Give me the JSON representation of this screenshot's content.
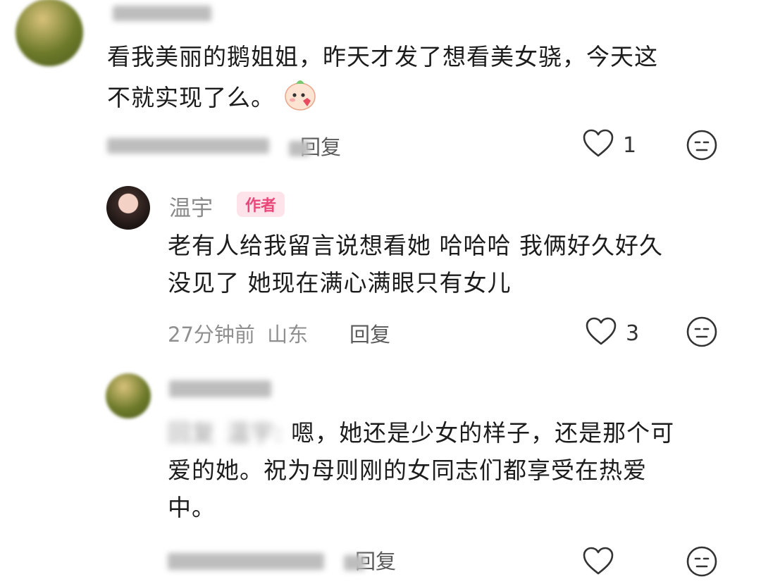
{
  "comments": [
    {
      "author_name": "",
      "text_line1": "看我美丽的鹅姐姐，昨天才发了想看美女骁，今天这",
      "text_line2": "不就实现了么。",
      "reply_label": "回复",
      "like_count": "1"
    },
    {
      "author_name": "温宇",
      "author_tag": "作者",
      "text_line1": "老有人给我留言说想看她 哈哈哈 我俩好久好久",
      "text_line2": "没见了 她现在满心满眼只有女儿",
      "time": "27分钟前",
      "location": "山东",
      "reply_label": "回复",
      "like_count": "3"
    },
    {
      "author_name": "",
      "reply_prefix": "回复",
      "reply_target": "温宇:",
      "text_line1": "嗯，她还是少女的样子，还是那个可",
      "text_line2": "爱的她。祝为母则刚的女同志们都享受在热爱",
      "text_line3": "中。",
      "reply_label": "回复"
    }
  ],
  "colors": {
    "author_tag": "#e8487a",
    "author_tag_bg": "#ffe3ea"
  }
}
